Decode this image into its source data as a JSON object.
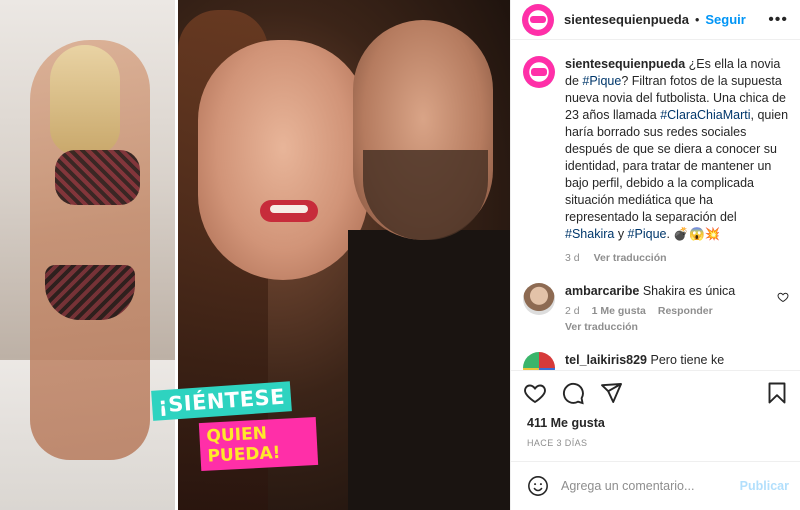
{
  "post": {
    "username": "sientesequienpueda",
    "follow_label": "Seguir",
    "dot": "•",
    "more_label": "•••"
  },
  "overlay": {
    "line1": "¡SIÉNTESE",
    "line2": "QUIEN PUEDA!"
  },
  "caption": {
    "username": "sientesequienpueda",
    "t1": " ¿Es ella la novia de ",
    "tag1": "#Pique",
    "t2": "? Filtran fotos de la supuesta nueva novia del futbolista. Una chica de 23 años llamada ",
    "tag2": "#ClaraChiaMarti",
    "t3": ", quien haría borrado sus redes sociales después de que se diera a conocer su identidad, para tratar de mantener un bajo perfil, debido a la complicada situación mediática que ha representado la separación del ",
    "tag3": "#Shakira",
    "t4": " y ",
    "tag4": "#Pique",
    "t5": ". 💣😱💥",
    "age": "3 d",
    "translate": "Ver traducción"
  },
  "comments": [
    {
      "username": "ambarcaribe",
      "text": "Shakira es única",
      "age": "2 d",
      "likes": "1 Me gusta",
      "reply": "Responder",
      "translate": "Ver traducción"
    },
    {
      "username": "tel_laikiris829",
      "text": "Pero tiene ke"
    }
  ],
  "engagement": {
    "likes": "411 Me gusta",
    "date": "HACE 3 DÍAS"
  },
  "composer": {
    "placeholder": "Agrega un comentario...",
    "post_label": "Publicar"
  }
}
